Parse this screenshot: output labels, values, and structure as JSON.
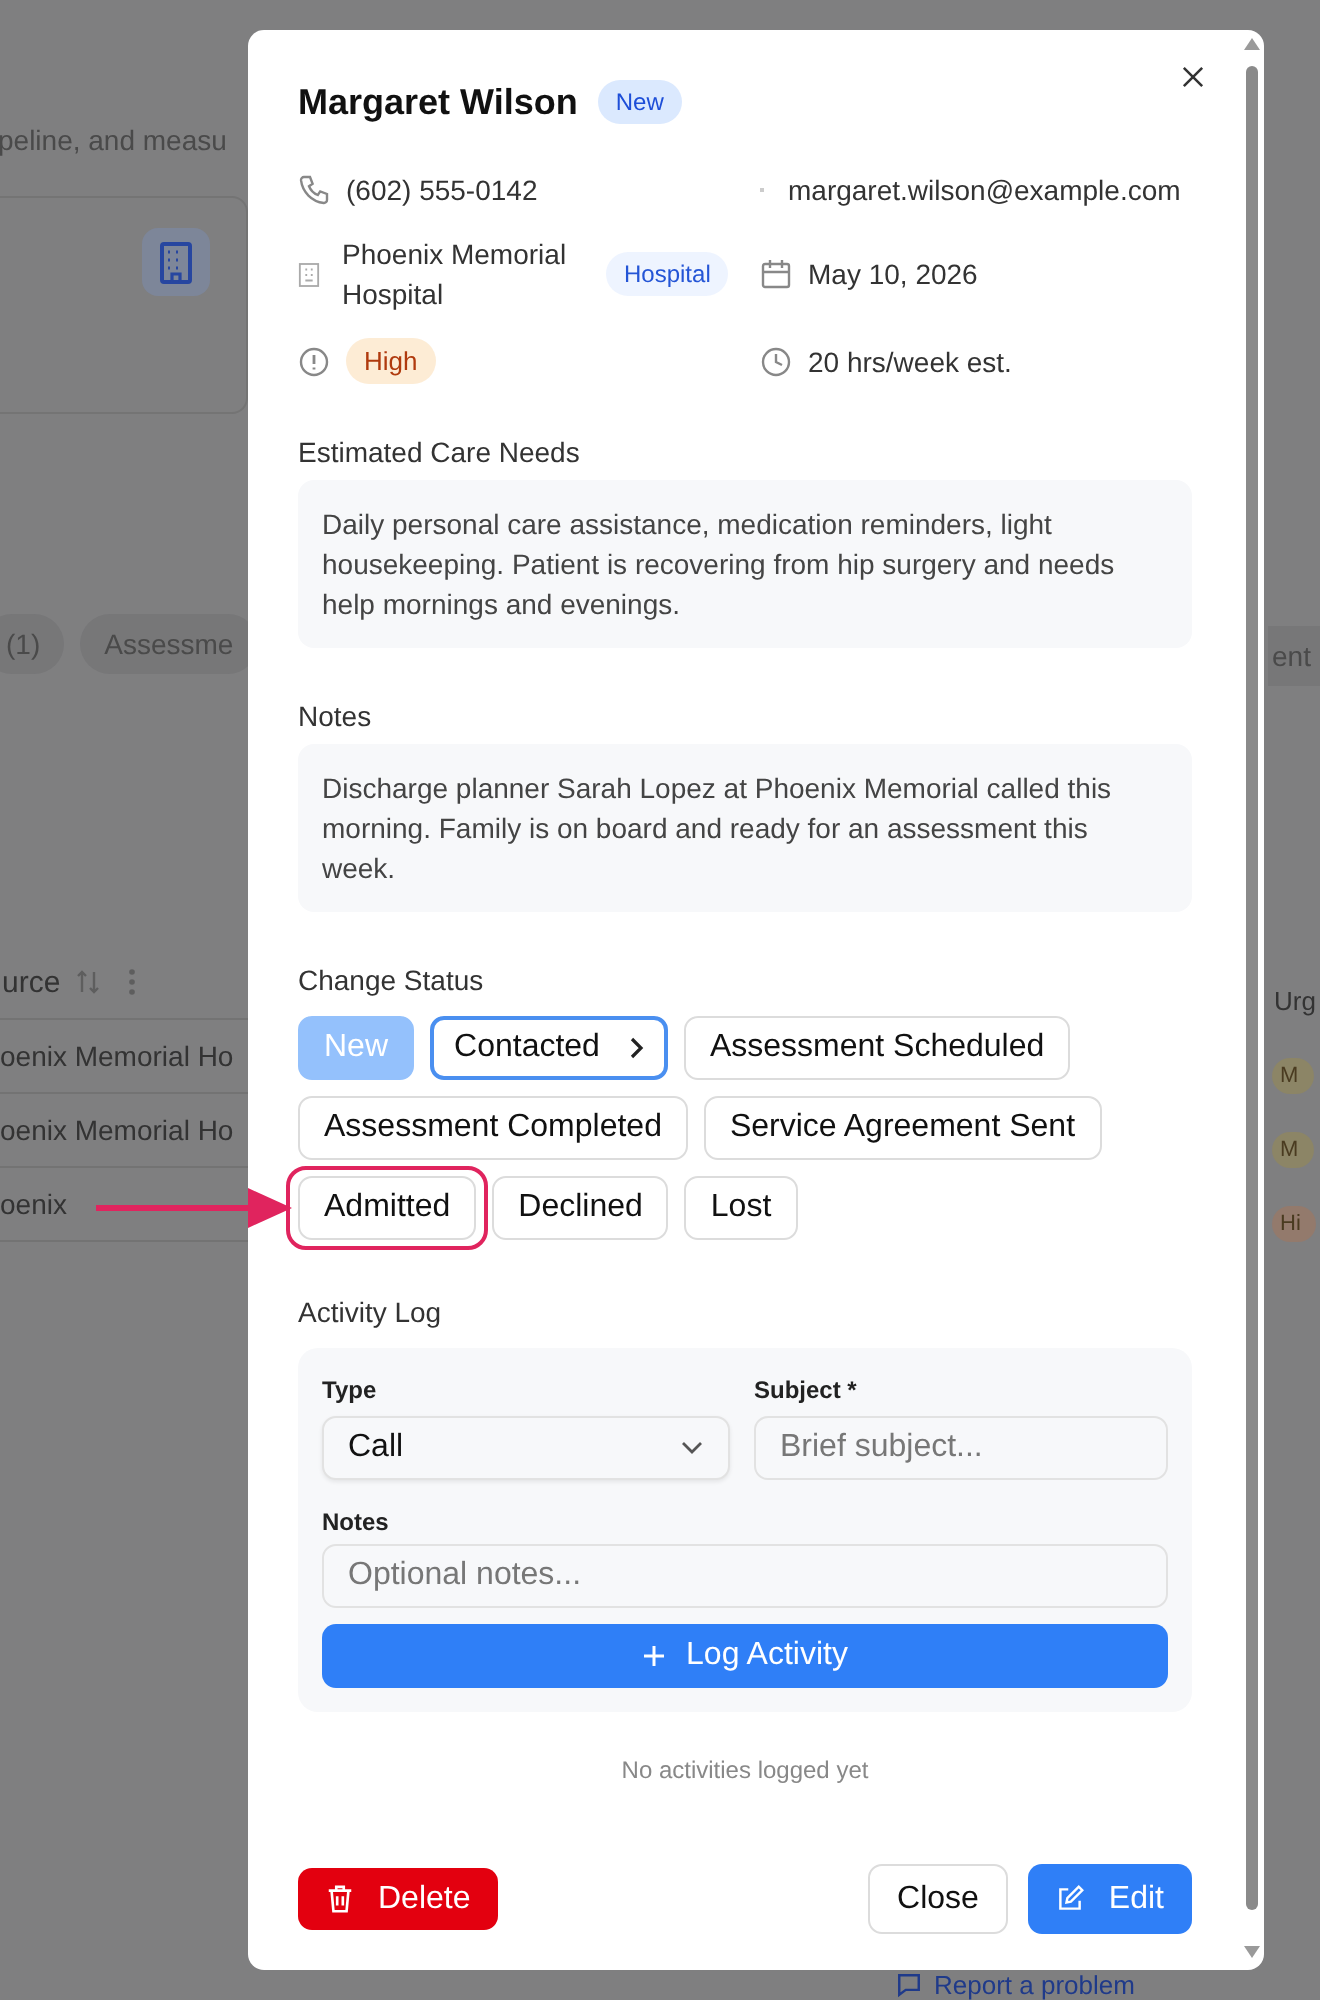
{
  "background": {
    "subtitle": "peline, and measu",
    "pills": [
      "(1)",
      "Assessme"
    ],
    "column_header": "urce",
    "rows": [
      "oenix Memorial Ho",
      "oenix Memorial Ho",
      "oenix"
    ],
    "right_pill": "ent",
    "right_header": "Urg",
    "right_badges": [
      {
        "label": "M",
        "color": "#8c8566"
      },
      {
        "label": "M",
        "color": "#8c8566"
      },
      {
        "label": "Hi",
        "color": "#937a6c"
      }
    ],
    "report_link": "Report a problem"
  },
  "lead": {
    "name": "Margaret Wilson",
    "status_badge": "New",
    "phone": "(602) 555-0142",
    "email": "margaret.wilson@example.com",
    "facility": "Phoenix Memorial Hospital",
    "facility_type": "Hospital",
    "date": "May 10, 2026",
    "urgency": "High",
    "hours": "20 hrs/week est."
  },
  "care_needs": {
    "label": "Estimated Care Needs",
    "text": "Daily personal care assistance, medication reminders, light housekeeping. Patient is recovering from hip surgery and needs help mornings and evenings."
  },
  "notes": {
    "label": "Notes",
    "text": "Discharge planner Sarah Lopez at Phoenix Memorial called this morning. Family is on board and ready for an assessment this week."
  },
  "status": {
    "label": "Change Status",
    "options": [
      {
        "label": "New",
        "selected": true,
        "suggested": false,
        "highlighted": false
      },
      {
        "label": "Contacted",
        "selected": false,
        "suggested": true,
        "highlighted": false
      },
      {
        "label": "Assessment Scheduled",
        "selected": false,
        "suggested": false,
        "highlighted": false
      },
      {
        "label": "Assessment Completed",
        "selected": false,
        "suggested": false,
        "highlighted": false
      },
      {
        "label": "Service Agreement Sent",
        "selected": false,
        "suggested": false,
        "highlighted": false
      },
      {
        "label": "Admitted",
        "selected": false,
        "suggested": false,
        "highlighted": true
      },
      {
        "label": "Declined",
        "selected": false,
        "suggested": false,
        "highlighted": false
      },
      {
        "label": "Lost",
        "selected": false,
        "suggested": false,
        "highlighted": false
      }
    ]
  },
  "activity": {
    "label": "Activity Log",
    "type_label": "Type",
    "type_value": "Call",
    "subject_label": "Subject *",
    "subject_placeholder": "Brief subject...",
    "notes_label": "Notes",
    "notes_placeholder": "Optional notes...",
    "button": "Log Activity",
    "empty": "No activities logged yet"
  },
  "footer": {
    "delete": "Delete",
    "close": "Close",
    "edit": "Edit"
  }
}
